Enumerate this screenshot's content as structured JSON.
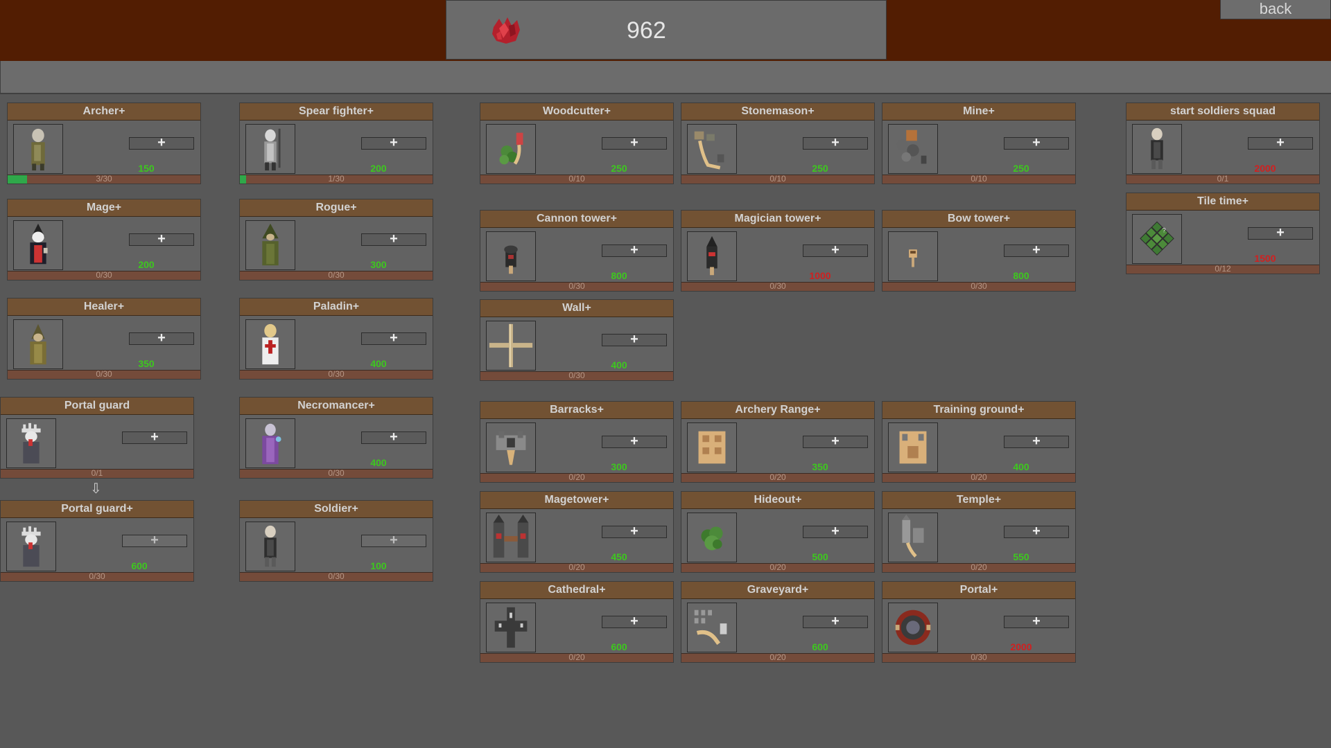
{
  "header": {
    "resource_value": "962",
    "resource_icon": "red-crystal-icon",
    "back_label": "back"
  },
  "colors": {
    "header_bg": "#521d02",
    "card_title_bg": "#725233",
    "cost_affordable": "#3dc81e",
    "cost_unaffordable": "#d02020",
    "progress_fill": "#2fa84a"
  },
  "cards": {
    "archer": {
      "title": "Archer+",
      "cost": "150",
      "progress": "3/30",
      "fraction": 0.1
    },
    "spear": {
      "title": "Spear fighter+",
      "cost": "200",
      "progress": "1/30",
      "fraction": 0.033
    },
    "woodcutter": {
      "title": "Woodcutter+",
      "cost": "250",
      "progress": "0/10"
    },
    "stonemason": {
      "title": "Stonemason+",
      "cost": "250",
      "progress": "0/10"
    },
    "mine": {
      "title": "Mine+",
      "cost": "250",
      "progress": "0/10"
    },
    "squad": {
      "title": "start soldiers squad",
      "cost": "2000",
      "progress": "0/1"
    },
    "mage": {
      "title": "Mage+",
      "cost": "200",
      "progress": "0/30"
    },
    "rogue": {
      "title": "Rogue+",
      "cost": "300",
      "progress": "0/30"
    },
    "cannon": {
      "title": "Cannon tower+",
      "cost": "800",
      "progress": "0/30"
    },
    "magician": {
      "title": "Magician tower+",
      "cost": "1000",
      "progress": "0/30"
    },
    "bow": {
      "title": "Bow tower+",
      "cost": "800",
      "progress": "0/30"
    },
    "tile": {
      "title": "Tile time+",
      "cost": "1500",
      "progress": "0/12"
    },
    "healer": {
      "title": "Healer+",
      "cost": "350",
      "progress": "0/30"
    },
    "paladin": {
      "title": "Paladin+",
      "cost": "400",
      "progress": "0/30"
    },
    "wall": {
      "title": "Wall+",
      "cost": "400",
      "progress": "0/30"
    },
    "portal_guard": {
      "title": "Portal guard",
      "progress": "0/1"
    },
    "necromancer": {
      "title": "Necromancer+",
      "cost": "400",
      "progress": "0/30"
    },
    "barracks": {
      "title": "Barracks+",
      "cost": "300",
      "progress": "0/20"
    },
    "archery": {
      "title": "Archery Range+",
      "cost": "350",
      "progress": "0/20"
    },
    "training": {
      "title": "Training ground+",
      "cost": "400",
      "progress": "0/20"
    },
    "portal_guard2": {
      "title": "Portal guard+",
      "cost": "600",
      "progress": "0/30"
    },
    "soldier": {
      "title": "Soldier+",
      "cost": "100",
      "progress": "0/30"
    },
    "magetower": {
      "title": "Magetower+",
      "cost": "450",
      "progress": "0/20"
    },
    "hideout": {
      "title": "Hideout+",
      "cost": "500",
      "progress": "0/20"
    },
    "temple": {
      "title": "Temple+",
      "cost": "550",
      "progress": "0/20"
    },
    "cathedral": {
      "title": "Cathedral+",
      "cost": "600",
      "progress": "0/20"
    },
    "graveyard": {
      "title": "Graveyard+",
      "cost": "600",
      "progress": "0/20"
    },
    "portal": {
      "title": "Portal+",
      "cost": "2000",
      "progress": "0/30"
    }
  },
  "plus_label": "+",
  "arrow": "⇩"
}
